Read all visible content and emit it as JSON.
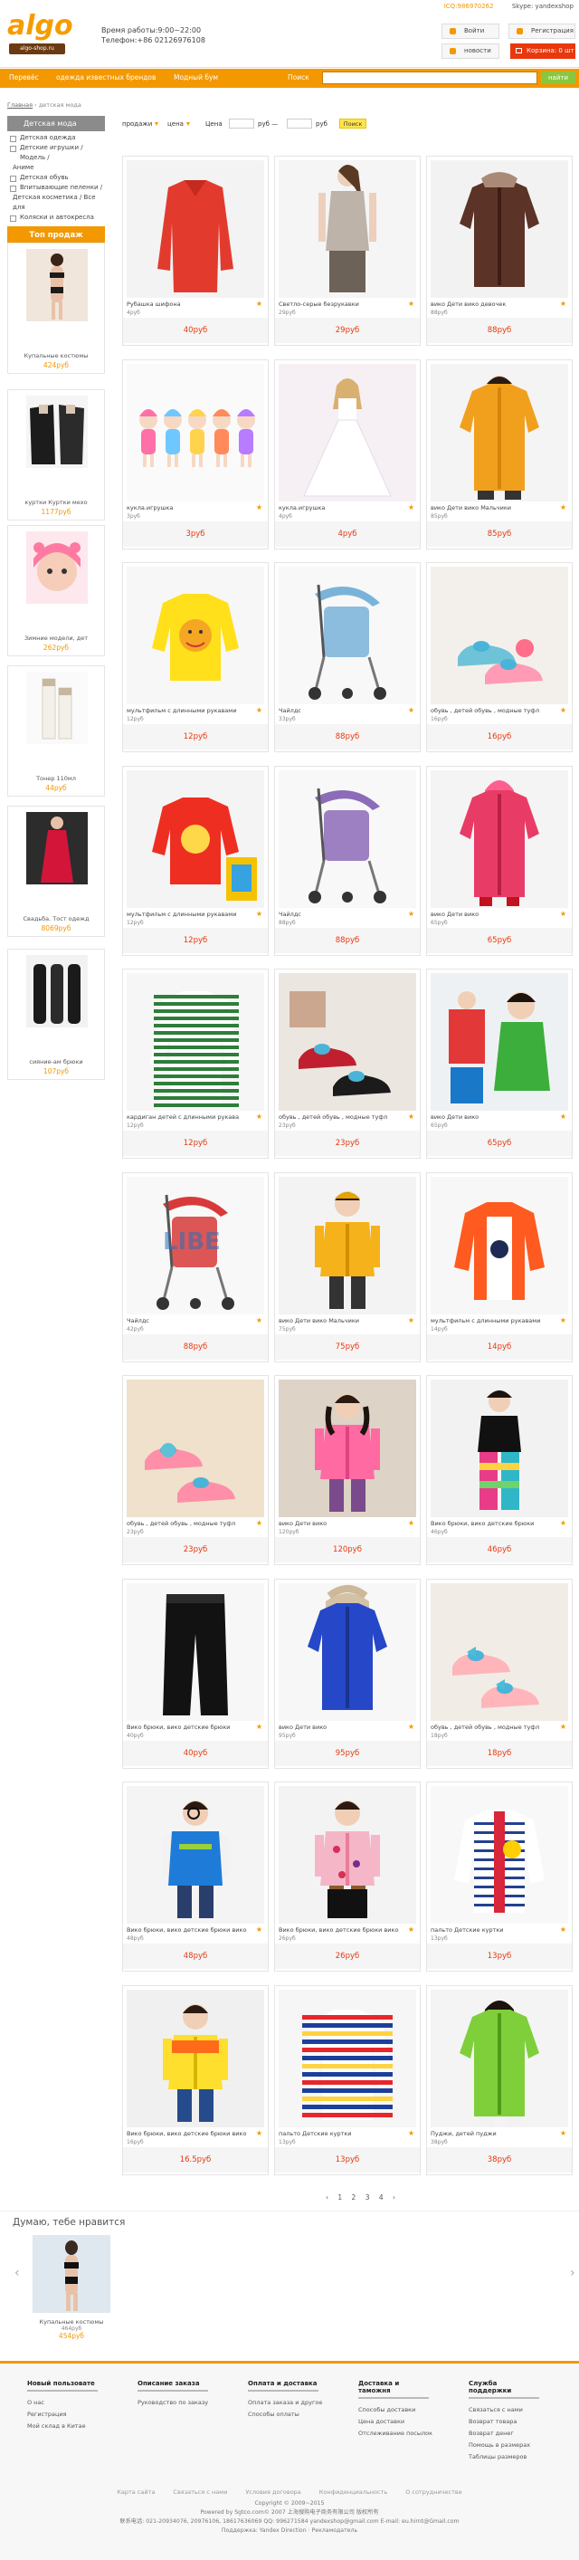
{
  "header": {
    "logo_text": "algo",
    "logo_sub": "algo-shop.ru",
    "hours": "Время работы:9:00~22:00",
    "phone": "Телефон:+86 02126976108",
    "qq": "ICQ:986970262",
    "skype": "Skype: yandexshop",
    "login": "Войти",
    "register": "Регистрация",
    "news": "новости",
    "cart": "Корзина: 0 шт"
  },
  "nav": {
    "items": [
      "Перевёс",
      "одежда известных брендов",
      "Модный бум",
      "Поиск"
    ],
    "search_button": "найти"
  },
  "breadcrumb": {
    "home": "Главная",
    "sep": " › ",
    "current": "детская мода"
  },
  "categories": {
    "title": "Детская мода",
    "items": [
      {
        "label": "Детская одежда",
        "box": true
      },
      {
        "label": "Детские игрушки / Модель /",
        "box": true
      },
      {
        "label": "Аниме",
        "box": false
      },
      {
        "label": "Детская обувь",
        "box": true
      },
      {
        "label": "Впитывающие пеленки /",
        "box": true
      },
      {
        "label": "Детская косметика / Все для",
        "box": false
      },
      {
        "label": "Коляски и автокресла",
        "box": true
      }
    ]
  },
  "top_sales": {
    "title": "Топ продаж",
    "items": [
      {
        "name": "Купальные костюмы",
        "price": "424руб"
      },
      {
        "name": "куртки Куртки мехо",
        "price": "1177руб"
      },
      {
        "name": "Зимние модели, дет",
        "price": "262руб"
      },
      {
        "name": "Тонер 110мл",
        "price": "44руб"
      },
      {
        "name": "Свадьба. Тост одежд",
        "price": "8069руб"
      },
      {
        "name": "сияние-ам брюки",
        "price": "107руб"
      }
    ]
  },
  "filters": {
    "sales": "продажи",
    "price": "цена",
    "label_price": "Цена",
    "from": "руб —",
    "to": "руб",
    "button": "Поиск"
  },
  "products": [
    {
      "name": "Рубашка шифона",
      "sub": "4руб",
      "price": "40руб",
      "art": "redshirt"
    },
    {
      "name": "Светло-серые безрукавки",
      "sub": "29руб",
      "price": "29руб",
      "art": "greytop"
    },
    {
      "name": "вико Дети вико девочек",
      "sub": "88руб",
      "price": "88руб",
      "art": "brownjacket"
    },
    {
      "name": "кукла.игрушка",
      "sub": "3руб",
      "price": "3руб",
      "art": "dolls"
    },
    {
      "name": "кукла.игрушка",
      "sub": "4руб",
      "price": "4руб",
      "art": "bridedoll"
    },
    {
      "name": "вико Дети вико Мальчики",
      "sub": "85руб",
      "price": "85руб",
      "art": "yellowcoat"
    },
    {
      "name": "мультфильм с длинными рукавами",
      "sub": "12руб",
      "price": "12руб",
      "art": "yellowtee"
    },
    {
      "name": "Чайлдс",
      "sub": "33руб",
      "price": "88руб",
      "art": "strollerblue"
    },
    {
      "name": "обувь , детей обувь , модные туфл",
      "sub": "16руб",
      "price": "16руб",
      "art": "shoes"
    },
    {
      "name": "мультфильм с длинными рукавами",
      "sub": "12руб",
      "price": "12руб",
      "art": "redtee"
    },
    {
      "name": "Чайлдс",
      "sub": "88руб",
      "price": "88руб",
      "art": "strollerpurple"
    },
    {
      "name": "вико Дети вико",
      "sub": "65руб",
      "price": "65руб",
      "art": "pinkcoat"
    },
    {
      "name": "кардиган детей с длинными рукава",
      "sub": "12руб",
      "price": "12руб",
      "art": "stripes"
    },
    {
      "name": "обувь , детей обувь , модные туфл",
      "sub": "23руб",
      "price": "23руб",
      "art": "shoes2"
    },
    {
      "name": "вико Дети вико",
      "sub": "65руб",
      "price": "65руб",
      "art": "greencoat"
    },
    {
      "name": "Чайлдс",
      "sub": "42руб",
      "price": "88руб",
      "art": "strollerred"
    },
    {
      "name": "вико Дети вико Мальчики",
      "sub": "75руб",
      "price": "75руб",
      "art": "boyyellow"
    },
    {
      "name": "мультфильм с длинными рукавами",
      "sub": "14руб",
      "price": "14руб",
      "art": "orangetee"
    },
    {
      "name": "обувь , детей обувь , модные туфл",
      "sub": "23руб",
      "price": "23руб",
      "art": "shoes3"
    },
    {
      "name": "вико Дети вико",
      "sub": "120руб",
      "price": "120руб",
      "art": "girlpink"
    },
    {
      "name": "Вико брюки, вико детские брюки",
      "sub": "46руб",
      "price": "46руб",
      "art": "girlpants"
    },
    {
      "name": "Вико брюки, вико детские брюки",
      "sub": "40руб",
      "price": "40руб",
      "art": "blackpants"
    },
    {
      "name": "вико Дети вико",
      "sub": "95руб",
      "price": "95руб",
      "art": "bluecoat"
    },
    {
      "name": "обувь , детей обувь , модные туфл",
      "sub": "18руб",
      "price": "18руб",
      "art": "shoes4"
    },
    {
      "name": "Вико брюки, вико детские брюки вико",
      "sub": "48руб",
      "price": "48руб",
      "art": "boyvest"
    },
    {
      "name": "Вико брюки, вико детские брюки вико",
      "sub": "26руб",
      "price": "26руб",
      "art": "girlfloral"
    },
    {
      "name": "пальто Детские куртки",
      "sub": "13руб",
      "price": "13руб",
      "art": "cardigan"
    },
    {
      "name": "Вико брюки, вико детские брюки вико",
      "sub": "16руб",
      "price": "16.5руб",
      "art": "boyyellowvest"
    },
    {
      "name": "пальто Детские куртки",
      "sub": "13руб",
      "price": "13руб",
      "art": "stripecoat"
    },
    {
      "name": "Пуджи, детей пуджи",
      "sub": "38руб",
      "price": "38руб",
      "art": "girlgreen"
    }
  ],
  "pagination": "‹ 1 2 3 4 ›",
  "like": {
    "title": "Думаю, тебе нравится",
    "item_name": "Купальные костюмы",
    "item_sub": "464руб",
    "item_price": "454руб"
  },
  "footer": {
    "cols": [
      {
        "title": "Новый пользовате",
        "items": [
          "О нас",
          "Регистрация",
          "Мой склад в Китае"
        ]
      },
      {
        "title": "Описание заказа",
        "items": [
          "Руководство по заказу"
        ]
      },
      {
        "title": "Оплата и доставка",
        "items": [
          "Оплата заказа и другое",
          "Способы оплаты"
        ]
      },
      {
        "title": "Доставка и таможня",
        "items": [
          "Способы доставки",
          "Цена доставки",
          "Отслеживание посылок"
        ]
      },
      {
        "title": "Служба поддержки",
        "items": [
          "Связаться с нами",
          "Возврат товара",
          "Возврат денег",
          "Помощь в размерах",
          "Таблицы размеров"
        ]
      }
    ],
    "bar": [
      "Карта сайта",
      "Связаться с нами",
      "Условия договора",
      "Конфиденциальность",
      "О сотрудничестве"
    ],
    "copyright": "Copyright © 2009~2015",
    "line1": "Powered by Sgtco.com© 2007 上海搜购电子商务有限公司 版权所有",
    "line2": "联系电话: 021-20934076, 20976106, 18617636069 QQ: 996271584 yandexshop@gmail.com E-mail: eu.hirnt@Gmail.com",
    "line3": "Поддержка: Yandex Direction · Рекламодатель"
  }
}
